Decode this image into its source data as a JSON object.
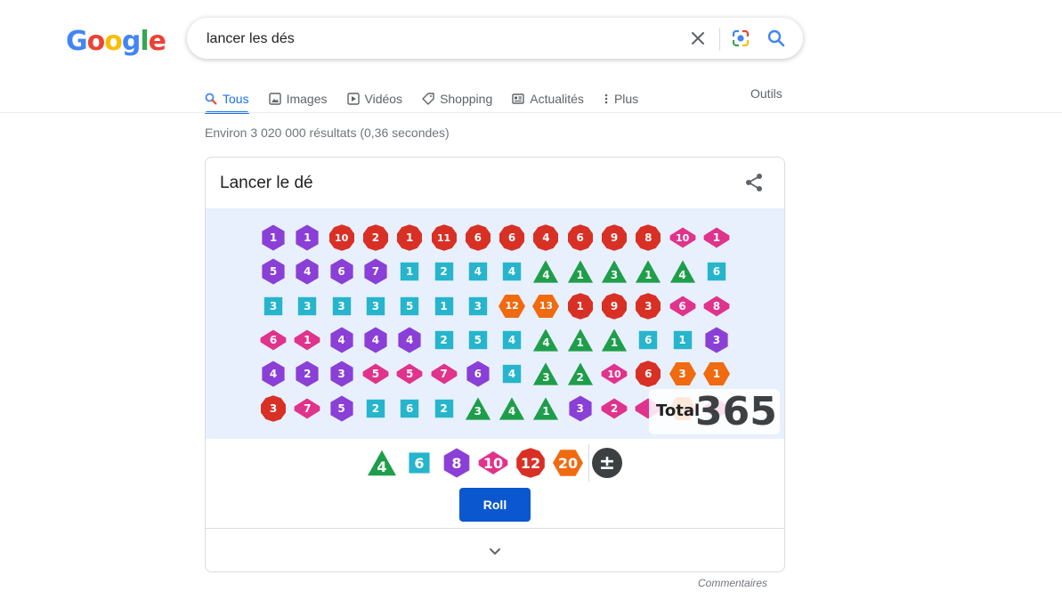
{
  "logo": {
    "letters": [
      "G",
      "o",
      "o",
      "g",
      "l",
      "e"
    ],
    "colors": [
      "#4285F4",
      "#EA4335",
      "#FBBC05",
      "#4285F4",
      "#34A853",
      "#EA4335"
    ]
  },
  "search": {
    "query": "lancer les dés"
  },
  "icons": {
    "clear": "close-icon",
    "lens": "camera-lens-icon",
    "search": "search-icon",
    "share": "share-icon",
    "expand": "chevron-down-icon"
  },
  "tabs": [
    {
      "label": "Tous",
      "icon": "search-icon",
      "active": true
    },
    {
      "label": "Images",
      "icon": "image-icon"
    },
    {
      "label": "Vidéos",
      "icon": "video-icon"
    },
    {
      "label": "Shopping",
      "icon": "tag-icon"
    },
    {
      "label": "Actualités",
      "icon": "news-icon"
    },
    {
      "label": "Plus",
      "icon": "more-vert-icon"
    }
  ],
  "tools_label": "Outils",
  "stats": "Environ 3 020 000 résultats (0,36 secondes)",
  "card": {
    "title": "Lancer le dé",
    "colors": {
      "d4": "#1e9e4a",
      "d6": "#26b5cc",
      "d8": "#8a3fd6",
      "d10": "#e0338c",
      "d12": "#d93025",
      "d20": "#f06a10",
      "custom": "#3c4043"
    },
    "dice_rows": [
      [
        [
          "d8",
          "1"
        ],
        [
          "d8",
          "1"
        ],
        [
          "d12",
          "10"
        ],
        [
          "d12",
          "2"
        ],
        [
          "d12",
          "1"
        ],
        [
          "d12",
          "11"
        ],
        [
          "d12",
          "6"
        ],
        [
          "d12",
          "6"
        ],
        [
          "d12",
          "4"
        ],
        [
          "d12",
          "6"
        ],
        [
          "d12",
          "9"
        ],
        [
          "d12",
          "8"
        ],
        [
          "d10",
          "10"
        ],
        [
          "d10",
          "1"
        ]
      ],
      [
        [
          "d8",
          "5"
        ],
        [
          "d8",
          "4"
        ],
        [
          "d8",
          "6"
        ],
        [
          "d8",
          "7"
        ],
        [
          "d6",
          "1"
        ],
        [
          "d6",
          "2"
        ],
        [
          "d6",
          "4"
        ],
        [
          "d6",
          "4"
        ],
        [
          "d4",
          "4"
        ],
        [
          "d4",
          "1"
        ],
        [
          "d4",
          "3"
        ],
        [
          "d4",
          "1"
        ],
        [
          "d4",
          "4"
        ],
        [
          "d6",
          "6"
        ]
      ],
      [
        [
          "d6",
          "3"
        ],
        [
          "d6",
          "3"
        ],
        [
          "d6",
          "3"
        ],
        [
          "d6",
          "3"
        ],
        [
          "d6",
          "5"
        ],
        [
          "d6",
          "1"
        ],
        [
          "d6",
          "3"
        ],
        [
          "d20",
          "12"
        ],
        [
          "d20",
          "13"
        ],
        [
          "d12",
          "1"
        ],
        [
          "d12",
          "9"
        ],
        [
          "d12",
          "3"
        ],
        [
          "d10",
          "6"
        ],
        [
          "d10",
          "8"
        ]
      ],
      [
        [
          "d10",
          "6"
        ],
        [
          "d10",
          "1"
        ],
        [
          "d8",
          "4"
        ],
        [
          "d8",
          "4"
        ],
        [
          "d8",
          "4"
        ],
        [
          "d6",
          "2"
        ],
        [
          "d6",
          "5"
        ],
        [
          "d6",
          "4"
        ],
        [
          "d4",
          "4"
        ],
        [
          "d4",
          "1"
        ],
        [
          "d4",
          "1"
        ],
        [
          "d6",
          "6"
        ],
        [
          "d6",
          "1"
        ],
        [
          "d8",
          "3"
        ]
      ],
      [
        [
          "d8",
          "4"
        ],
        [
          "d8",
          "2"
        ],
        [
          "d8",
          "3"
        ],
        [
          "d10",
          "5"
        ],
        [
          "d10",
          "5"
        ],
        [
          "d10",
          "7"
        ],
        [
          "d8",
          "6"
        ],
        [
          "d6",
          "4"
        ],
        [
          "d4",
          "3"
        ],
        [
          "d4",
          "2"
        ],
        [
          "d10",
          "10"
        ],
        [
          "d12",
          "6"
        ],
        [
          "d20",
          "3"
        ],
        [
          "d20",
          "1"
        ]
      ],
      [
        [
          "d12",
          "3"
        ],
        [
          "d10",
          "7"
        ],
        [
          "d8",
          "5"
        ],
        [
          "d6",
          "2"
        ],
        [
          "d6",
          "6"
        ],
        [
          "d6",
          "2"
        ],
        [
          "d4",
          "3"
        ],
        [
          "d4",
          "4"
        ],
        [
          "d4",
          "1"
        ],
        [
          "d8",
          "3"
        ],
        [
          "d10",
          "2"
        ],
        [
          "d10",
          ""
        ],
        [
          "d20",
          ""
        ],
        [
          "d10",
          ""
        ]
      ]
    ],
    "total_label": "Total",
    "total_value": "365",
    "selector": [
      {
        "type": "d4",
        "label": "4"
      },
      {
        "type": "d6",
        "label": "6"
      },
      {
        "type": "d8",
        "label": "8"
      },
      {
        "type": "d10",
        "label": "10"
      },
      {
        "type": "d12",
        "label": "12"
      },
      {
        "type": "d20",
        "label": "20"
      },
      {
        "type": "custom",
        "label": "±"
      }
    ],
    "roll_label": "Roll"
  },
  "feedback_label": "Commentaires"
}
